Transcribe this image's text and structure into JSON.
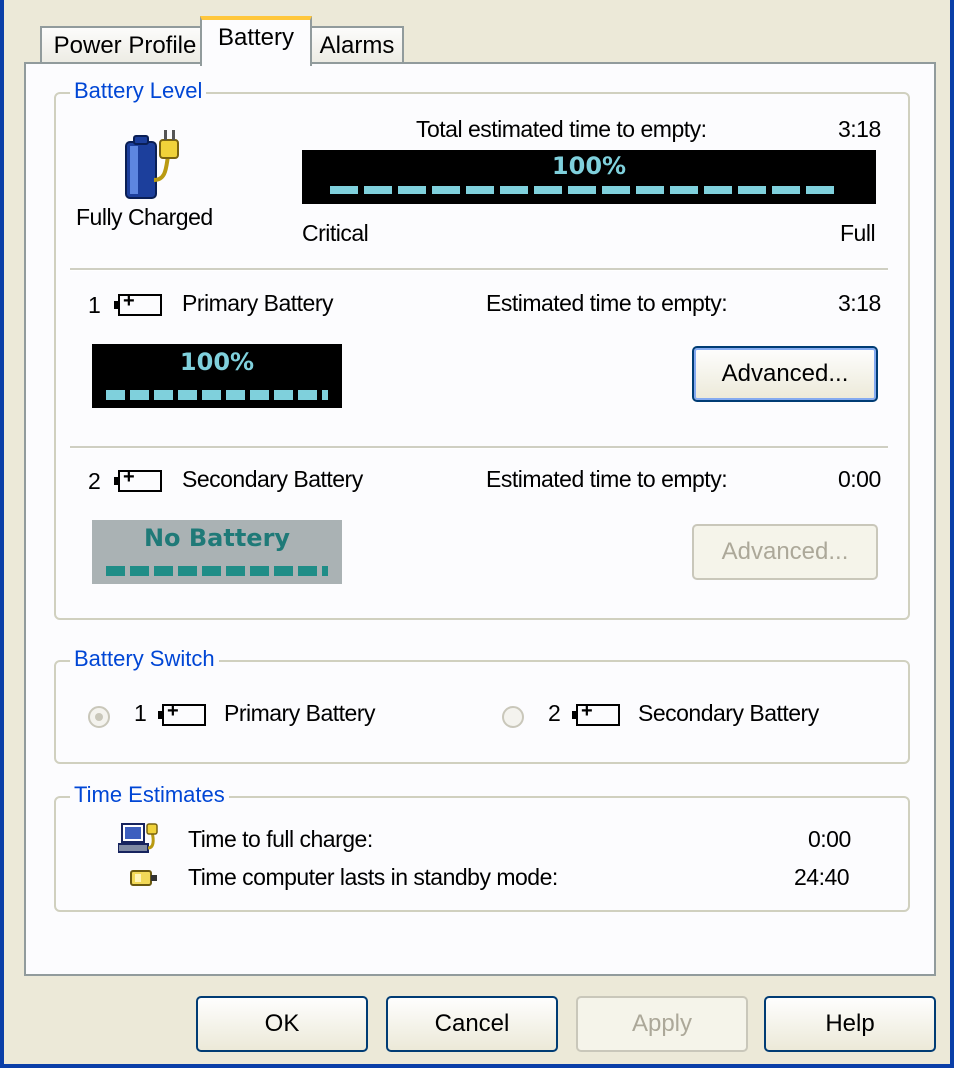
{
  "tabs": [
    "Power Profile",
    "Battery",
    "Alarms"
  ],
  "battery_level": {
    "title": "Battery Level",
    "status": "Fully Charged",
    "total_label": "Total estimated time to empty:",
    "total_value": "3:18",
    "meter_percent": "100%",
    "scale_min": "Critical",
    "scale_max": "Full",
    "primary": {
      "number": "1",
      "name": "Primary Battery",
      "time_label": "Estimated time to empty:",
      "time_value": "3:18",
      "meter_percent": "100%",
      "button": "Advanced..."
    },
    "secondary": {
      "number": "2",
      "name": "Secondary Battery",
      "time_label": "Estimated time to empty:",
      "time_value": "0:00",
      "meter_text": "No Battery",
      "button": "Advanced..."
    }
  },
  "battery_switch": {
    "title": "Battery Switch",
    "option1_number": "1",
    "option1": "Primary Battery",
    "option2_number": "2",
    "option2": "Secondary Battery"
  },
  "time_estimates": {
    "title": "Time Estimates",
    "full_charge_label": "Time to full charge:",
    "full_charge_value": "0:00",
    "standby_label": "Time computer lasts in standby mode:",
    "standby_value": "24:40"
  },
  "buttons": {
    "ok": "OK",
    "cancel": "Cancel",
    "apply": "Apply",
    "help": "Help"
  },
  "icons": {
    "status_icon": "battery-with-plug-icon",
    "full_charge_icon": "laptop-plug-icon",
    "standby_icon": "standby-battery-icon"
  }
}
